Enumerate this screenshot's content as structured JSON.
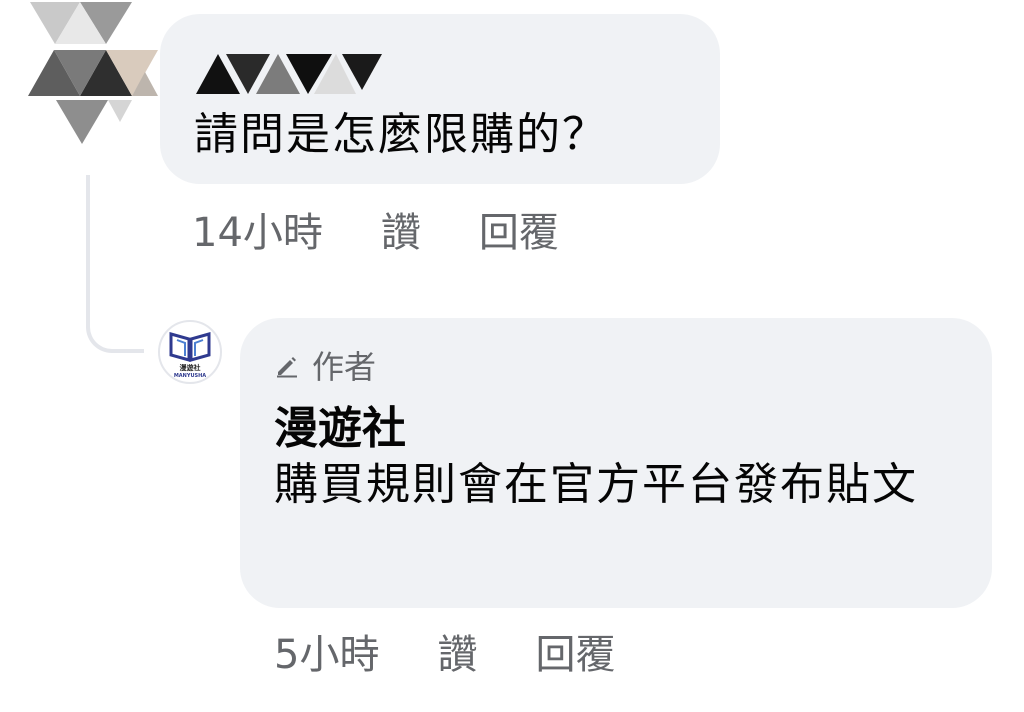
{
  "comments": [
    {
      "text": "請問是怎麼限購的？",
      "time": "14小時",
      "like_label": "讚",
      "reply_label": "回覆"
    }
  ],
  "reply": {
    "badge": "作者",
    "author": "漫遊社",
    "text": "購買規則會在官方平台發布貼文",
    "time": "5小時",
    "like_label": "讚",
    "reply_label": "回覆",
    "avatar_logo_text": "漫遊社",
    "avatar_logo_subtext": "MANYUSHA"
  },
  "icons": {
    "author_badge_icon": "pencil-icon",
    "obscured_avatar": "pixelated-avatar-icon",
    "page_avatar": "open-book-logo-icon"
  },
  "colors": {
    "bubble_bg": "#f0f2f5",
    "primary_text": "#050505",
    "secondary_text": "#65676b",
    "thread_line": "#e4e6eb",
    "logo_blue": "#2f3a8f"
  }
}
